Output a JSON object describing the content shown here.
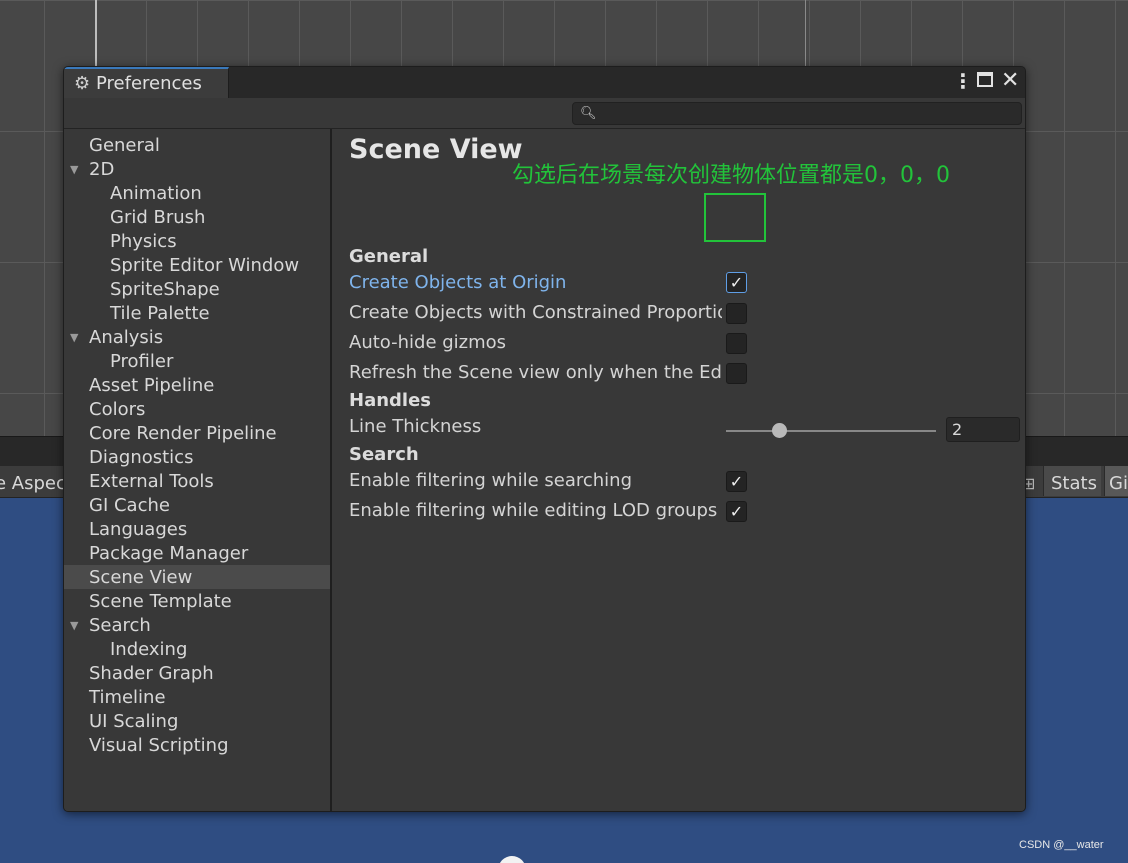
{
  "background": {
    "game_toolbar": {
      "aspect_label": "e Aspect",
      "grid_icon": "grid-icon",
      "stats_label": "Stats",
      "gizmos_label": "Gi"
    },
    "watermark": "CSDN @__water",
    "colors": {
      "game_view_bg": "#2f4d82",
      "scene_bg": "#474747"
    }
  },
  "window": {
    "title": "Preferences",
    "title_icon": "gear-icon",
    "controls": {
      "menu": "⋮",
      "maximize": "maximize-icon",
      "close": "✕"
    },
    "search": {
      "placeholder": "",
      "value": ""
    },
    "colors": {
      "accent": "#3a79bb",
      "link": "#7fb4ec",
      "annotation": "#22c33a"
    }
  },
  "sidebar": {
    "items": [
      {
        "label": "General",
        "level": 0,
        "expandable": false,
        "selected": false
      },
      {
        "label": "2D",
        "level": 0,
        "expandable": true,
        "selected": false
      },
      {
        "label": "Animation",
        "level": 1,
        "expandable": false,
        "selected": false
      },
      {
        "label": "Grid Brush",
        "level": 1,
        "expandable": false,
        "selected": false
      },
      {
        "label": "Physics",
        "level": 1,
        "expandable": false,
        "selected": false
      },
      {
        "label": "Sprite Editor Window",
        "level": 1,
        "expandable": false,
        "selected": false
      },
      {
        "label": "SpriteShape",
        "level": 1,
        "expandable": false,
        "selected": false
      },
      {
        "label": "Tile Palette",
        "level": 1,
        "expandable": false,
        "selected": false
      },
      {
        "label": "Analysis",
        "level": 0,
        "expandable": true,
        "selected": false
      },
      {
        "label": "Profiler",
        "level": 1,
        "expandable": false,
        "selected": false
      },
      {
        "label": "Asset Pipeline",
        "level": 0,
        "expandable": false,
        "selected": false
      },
      {
        "label": "Colors",
        "level": 0,
        "expandable": false,
        "selected": false
      },
      {
        "label": "Core Render Pipeline",
        "level": 0,
        "expandable": false,
        "selected": false
      },
      {
        "label": "Diagnostics",
        "level": 0,
        "expandable": false,
        "selected": false
      },
      {
        "label": "External Tools",
        "level": 0,
        "expandable": false,
        "selected": false
      },
      {
        "label": "GI Cache",
        "level": 0,
        "expandable": false,
        "selected": false
      },
      {
        "label": "Languages",
        "level": 0,
        "expandable": false,
        "selected": false
      },
      {
        "label": "Package Manager",
        "level": 0,
        "expandable": false,
        "selected": false
      },
      {
        "label": "Scene View",
        "level": 0,
        "expandable": false,
        "selected": true
      },
      {
        "label": "Scene Template",
        "level": 0,
        "expandable": false,
        "selected": false
      },
      {
        "label": "Search",
        "level": 0,
        "expandable": true,
        "selected": false
      },
      {
        "label": "Indexing",
        "level": 1,
        "expandable": false,
        "selected": false
      },
      {
        "label": "Shader Graph",
        "level": 0,
        "expandable": false,
        "selected": false
      },
      {
        "label": "Timeline",
        "level": 0,
        "expandable": false,
        "selected": false
      },
      {
        "label": "UI Scaling",
        "level": 0,
        "expandable": false,
        "selected": false
      },
      {
        "label": "Visual Scripting",
        "level": 0,
        "expandable": false,
        "selected": false
      }
    ]
  },
  "content": {
    "title": "Scene View",
    "sections": {
      "general": "General",
      "handles": "Handles",
      "search": "Search"
    },
    "settings": {
      "create_at_origin": {
        "label": "Create Objects at Origin",
        "checked": true
      },
      "constrained_proportions": {
        "label": "Create Objects with Constrained Proportions",
        "checked": false
      },
      "auto_hide_gizmos": {
        "label": "Auto-hide gizmos",
        "checked": false
      },
      "refresh_scene_view": {
        "label": "Refresh the Scene view only when the Editor is in focus",
        "checked": false
      },
      "line_thickness": {
        "label": "Line Thickness",
        "value": "2",
        "fraction": 0.25
      },
      "enable_filtering_search": {
        "label": "Enable filtering while searching",
        "checked": true
      },
      "enable_filtering_lod": {
        "label": "Enable filtering while editing LOD groups",
        "checked": true
      }
    }
  },
  "annotation": {
    "text": "勾选后在场景每次创建物体位置都是0，0，0"
  }
}
